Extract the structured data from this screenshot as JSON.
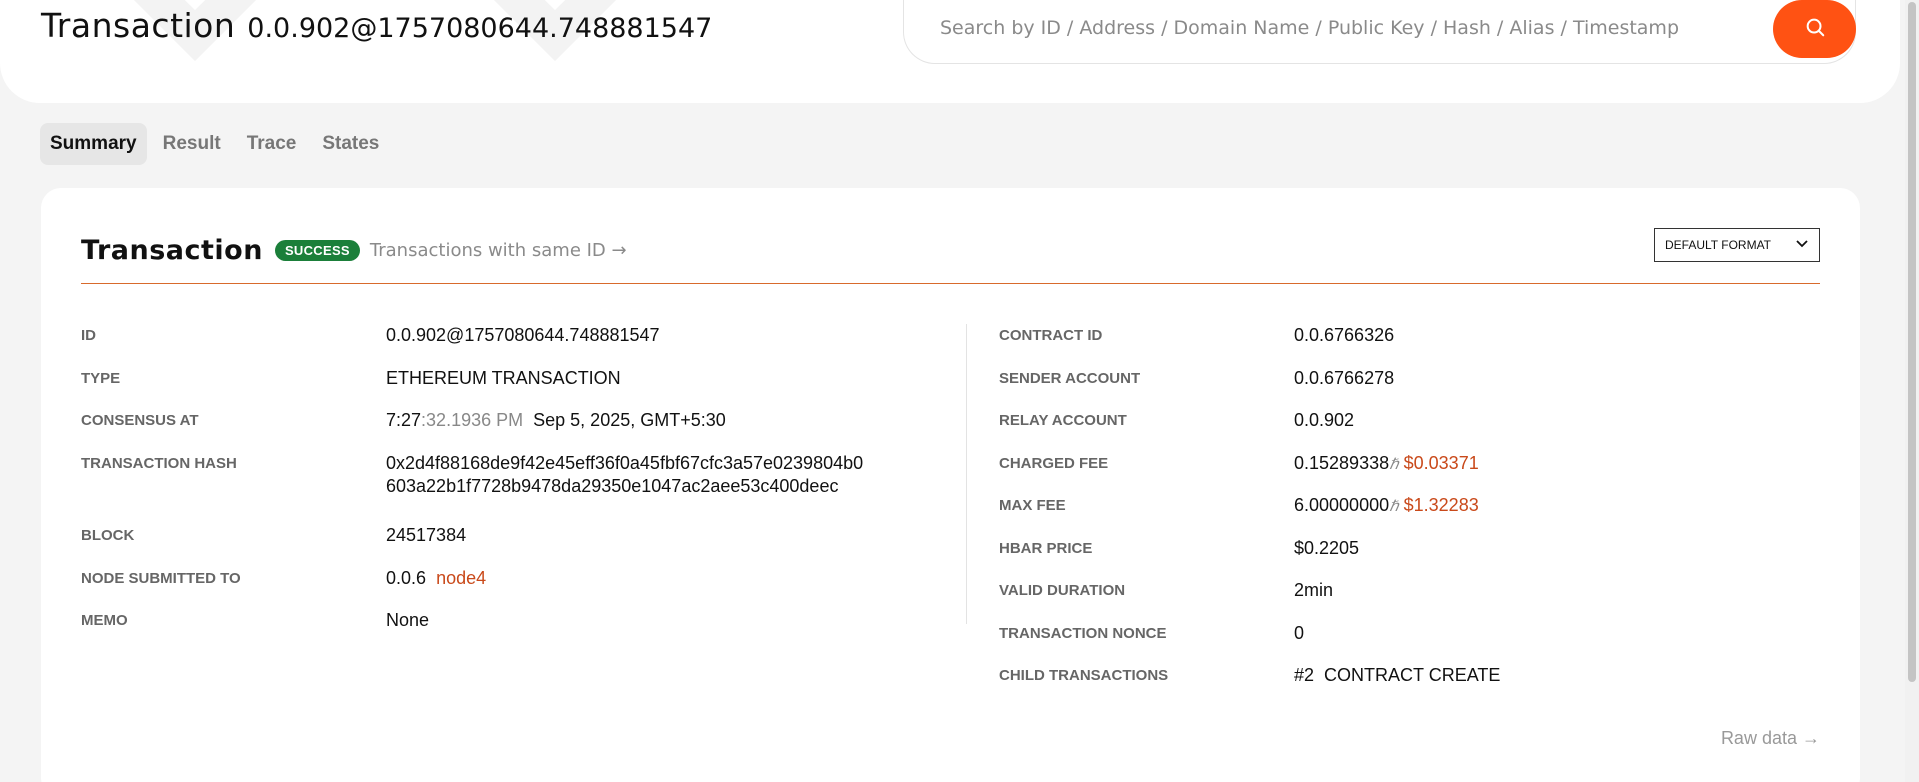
{
  "header": {
    "title_label": "Transaction",
    "title_value": "0.0.902@1757080644.748881547",
    "search_placeholder": "Search by ID / Address / Domain Name / Public Key / Hash / Alias / Timestamp",
    "search_icon": "search-icon",
    "accent_color": "#ff5213"
  },
  "tabs": [
    {
      "label": "Summary",
      "active": true
    },
    {
      "label": "Result",
      "active": false
    },
    {
      "label": "Trace",
      "active": false
    },
    {
      "label": "States",
      "active": false
    }
  ],
  "card": {
    "title": "Transaction",
    "status_badge": "SUCCESS",
    "same_id_link": "Transactions with same ID",
    "format_select": "DEFAULT FORMAT",
    "raw_data_link": "Raw data",
    "left": {
      "id": {
        "key": "ID",
        "value": "0.0.902@1757080644.748881547"
      },
      "type": {
        "key": "TYPE",
        "value": "ETHEREUM TRANSACTION"
      },
      "consensus": {
        "key": "CONSENSUS AT",
        "time_main": "7:27",
        "time_sub": ":32.1936 PM",
        "date": "Sep 5, 2025, GMT+5:30"
      },
      "hash": {
        "key": "TRANSACTION HASH",
        "line1": "0x2d4f88168de9f42e45eff36f0a45fbf67cfc3a57e0239804b0",
        "line2": "603a22b1f7728b9478da29350e1047ac2aee53c400deec"
      },
      "block": {
        "key": "BLOCK",
        "value": "24517384"
      },
      "node": {
        "key": "NODE SUBMITTED TO",
        "value": "0.0.6",
        "node_name": "node4"
      },
      "memo": {
        "key": "MEMO",
        "value": "None"
      }
    },
    "right": {
      "contract_id": {
        "key": "CONTRACT ID",
        "value": "0.0.6766326"
      },
      "sender": {
        "key": "SENDER ACCOUNT",
        "value": "0.0.6766278"
      },
      "relay": {
        "key": "RELAY ACCOUNT",
        "value": "0.0.902"
      },
      "charged_fee": {
        "key": "CHARGED FEE",
        "value": "0.15289338",
        "unit": "ℏ",
        "usd": "$0.03371"
      },
      "max_fee": {
        "key": "MAX FEE",
        "value": "6.00000000",
        "unit": "ℏ",
        "usd": "$1.32283"
      },
      "hbar_price": {
        "key": "HBAR PRICE",
        "value": "$0.2205"
      },
      "valid_duration": {
        "key": "VALID DURATION",
        "value": "2min"
      },
      "nonce": {
        "key": "TRANSACTION NONCE",
        "value": "0"
      },
      "child": {
        "key": "CHILD TRANSACTIONS",
        "index": "#2",
        "value": "CONTRACT CREATE"
      }
    }
  }
}
